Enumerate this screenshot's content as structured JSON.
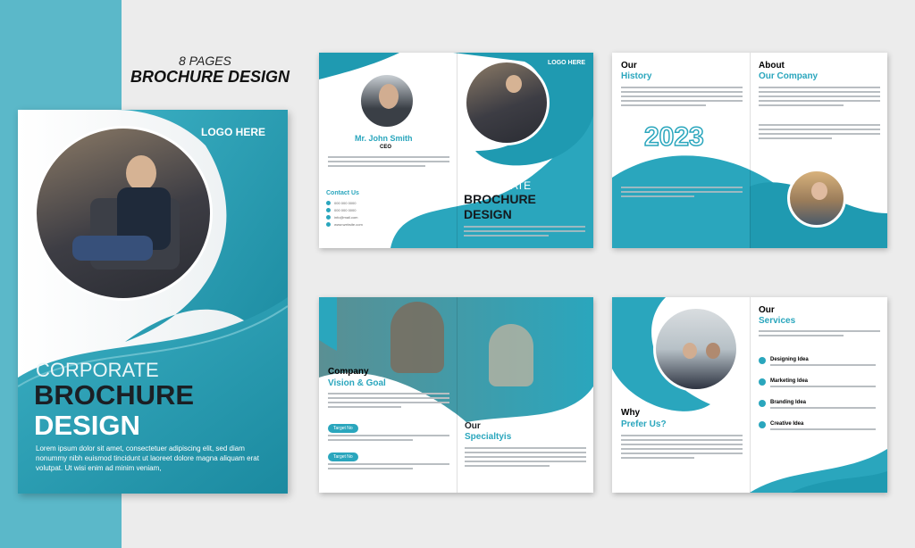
{
  "header": {
    "pages": "8 PAGES",
    "title": "BROCHURE DESIGN"
  },
  "cover": {
    "logo": "LOGO HERE",
    "line1": "CORPORATE",
    "line2": "BROCHURE",
    "line3": "DESIGN",
    "body": "Lorem ipsum dolor sit amet, consectetuer adipiscing elit, sed diam nonummy nibh euismod tincidunt ut laoreet dolore magna aliquam erat volutpat. Ut wisi enim ad minim veniam,"
  },
  "spread1": {
    "name": "Mr. John Smith",
    "role": "CEO",
    "contact": "Contact Us",
    "logo": "LOGO HERE",
    "line1": "CORPORATE",
    "line2": "BROCHURE",
    "line3": "DESIGN",
    "phone1": "000 000 0000",
    "phone2": "000 000 0000",
    "email": "info@mail.com",
    "web": "www.website.com"
  },
  "spread2": {
    "history1": "Our",
    "history2": "History",
    "year": "2023",
    "about1": "About",
    "about2": "Our Company"
  },
  "spread3": {
    "vision1": "Company",
    "vision2": "Vision & Goal",
    "target1": "Target No",
    "target2": "Target No",
    "spec1": "Our",
    "spec2": "Specialtyis"
  },
  "spread4": {
    "why1": "Why",
    "why2": "Prefer Us?",
    "serv1": "Our",
    "serv2": "Services",
    "services": [
      "Designing Idea",
      "Marketing Idea",
      "Branding Idea",
      "Creative Idea"
    ]
  },
  "lorem": "Lorem ipsum dolor sit amet, consectetuer adipiscing elit, sed diam nonummy nibh euismod tincidunt ut laoreet"
}
